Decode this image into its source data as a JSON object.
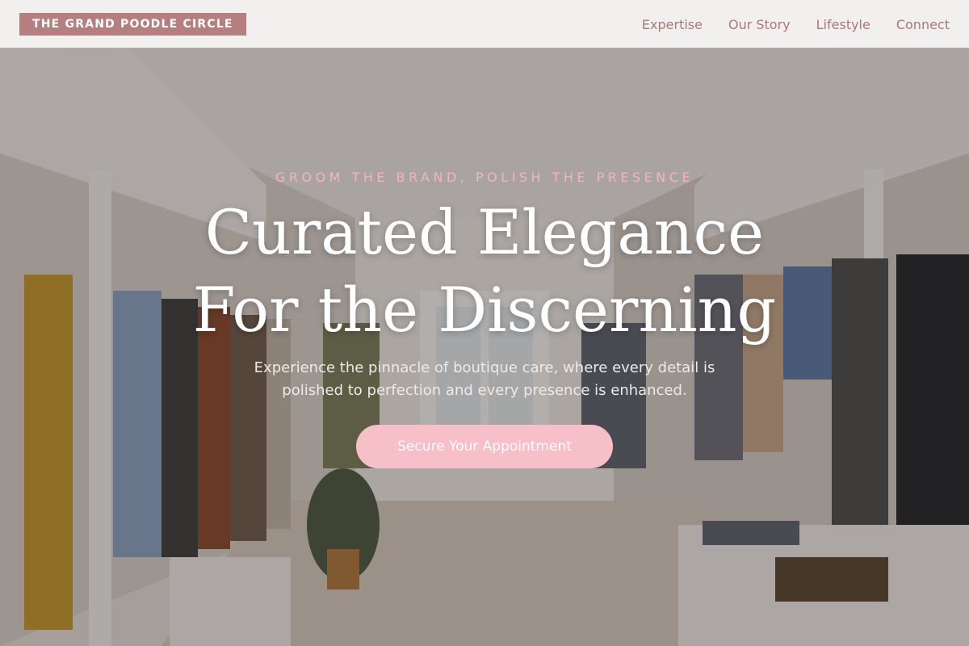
{
  "header": {
    "brand": "THE GRAND POODLE CIRCLE",
    "nav": [
      {
        "label": "Expertise"
      },
      {
        "label": "Our Story"
      },
      {
        "label": "Lifestyle"
      },
      {
        "label": "Connect"
      }
    ]
  },
  "hero": {
    "eyebrow": "GROOM THE BRAND, POLISH THE PRESENCE",
    "headline_line1": "Curated Elegance",
    "headline_line2": "For the Discerning",
    "subcopy": "Experience the pinnacle of boutique care, where every detail is polished to perfection and every presence is enhanced.",
    "cta_label": "Secure Your Appointment",
    "background": "boutique clothing store interior with garment racks"
  },
  "colors": {
    "brand_badge": "#b57f80",
    "nav_text": "#a9787a",
    "eyebrow": "#f2b5bc",
    "cta": "#f7bfc7"
  }
}
